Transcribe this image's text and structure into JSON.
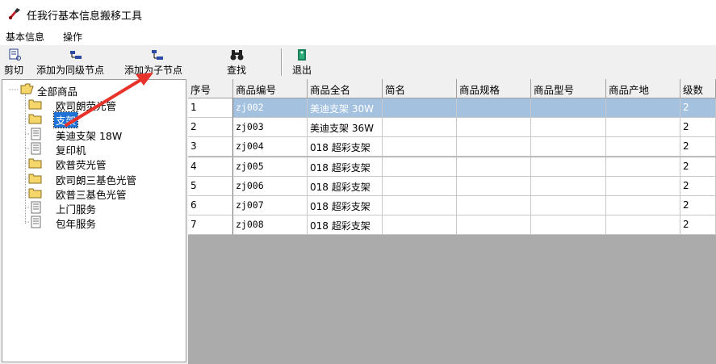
{
  "window": {
    "title": "任我行基本信息搬移工具",
    "icon": "app-wrench-icon"
  },
  "menu": [
    {
      "label": "基本信息"
    },
    {
      "label": "操作"
    }
  ],
  "toolbar": [
    {
      "label": "剪切",
      "icon": "cut-icon"
    },
    {
      "label": "添加为同级节点",
      "icon": "add-sibling-icon"
    },
    {
      "label": "添加为子节点",
      "icon": "add-child-icon"
    },
    {
      "label": "查找",
      "icon": "binoculars-icon"
    },
    {
      "label": "退出",
      "icon": "exit-icon"
    }
  ],
  "tree": {
    "root": "全部商品",
    "items": [
      {
        "label": "欧司朗荧光管",
        "type": "folder"
      },
      {
        "label": "支架",
        "type": "folder",
        "selected": true
      },
      {
        "label": "美迪支架 18W",
        "type": "doc"
      },
      {
        "label": "复印机",
        "type": "doc"
      },
      {
        "label": "欧普荧光管",
        "type": "folder"
      },
      {
        "label": "欧司朗三基色光管",
        "type": "folder"
      },
      {
        "label": "欧普三基色光管",
        "type": "folder"
      },
      {
        "label": "上门服务",
        "type": "doc"
      },
      {
        "label": "包年服务",
        "type": "doc"
      }
    ]
  },
  "table": {
    "columns": [
      "序号",
      "商品编号",
      "商品全名",
      "简名",
      "商品规格",
      "商品型号",
      "商品产地",
      "级数"
    ],
    "rows": [
      [
        "1",
        "zj002",
        "美迪支架 30W",
        "",
        "",
        "",
        "",
        "2"
      ],
      [
        "2",
        "zj003",
        "美迪支架 36W",
        "",
        "",
        "",
        "",
        "2"
      ],
      [
        "3",
        "zj004",
        "018 超彩支架",
        "",
        "",
        "",
        "",
        "2"
      ],
      [
        "4",
        "zj005",
        "018 超彩支架",
        "",
        "",
        "",
        "",
        "2"
      ],
      [
        "5",
        "zj006",
        "018 超彩支架",
        "",
        "",
        "",
        "",
        "2"
      ],
      [
        "6",
        "zj007",
        "018 超彩支架",
        "",
        "",
        "",
        "",
        "2"
      ],
      [
        "7",
        "zj008",
        "018 超彩支架",
        "",
        "",
        "",
        "",
        "2"
      ]
    ],
    "selected_row": 0
  },
  "colors": {
    "selection": "#1f73d7",
    "selected_row": "#a4c2e0",
    "annotation_arrow": "#e8332a"
  }
}
